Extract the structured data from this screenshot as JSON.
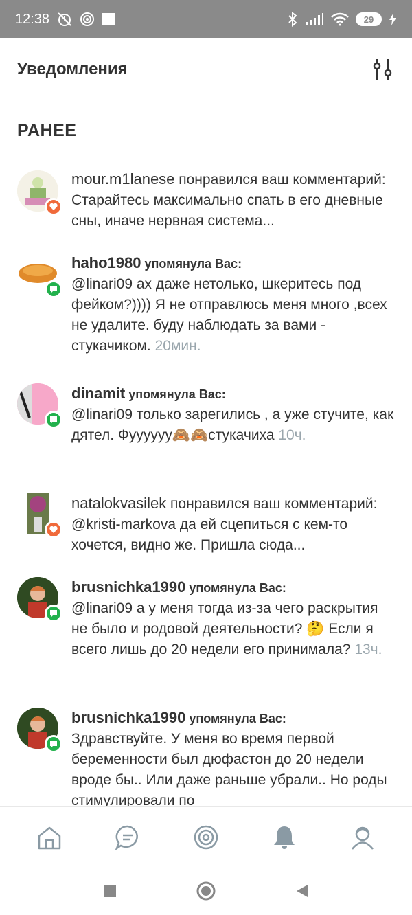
{
  "status_bar": {
    "time": "12:38",
    "battery": "29"
  },
  "header": {
    "title": "Уведомления"
  },
  "section": {
    "title": "РАНЕЕ"
  },
  "notifications": [
    {
      "user": "mour.m1lanese",
      "action": " понравился ваш",
      "body": "комментарий: Старайтесь максимально спать в его дневные сны, иначе нервная система...",
      "time": "",
      "type": "like",
      "avatar_color": "#cfe3a9"
    },
    {
      "user": "haho1980",
      "action": " упомянула Вас:",
      "body": "@linari09 ах даже нетолько, шкеритесь под фейком?)))) Я не отправлюсь меня много ,всех не удалите. буду наблюдать за вами - стукачиком.",
      "time": "20мин.",
      "type": "comment",
      "avatar_color": "#e08a2a"
    },
    {
      "user": "dinamit",
      "action": " упомянула Вас:",
      "body": "@linari09 только зарегились , а уже стучите, как дятел. Фуууууу🙈🙈стукачиха",
      "time": "10ч.",
      "type": "comment",
      "avatar_color": "#f7a8c9"
    },
    {
      "user": "natalokvasilek",
      "action": " понравился ваш",
      "body": "комментарий: @kristi-markova да ей сцепиться с кем-то хочется, видно же. Пришла сюда...",
      "time": "",
      "type": "like",
      "avatar_color": "#a3437f"
    },
    {
      "user": "brusnichka1990",
      "action": " упомянула Вас:",
      "body": "@linari09  а у меня тогда из-за чего раскрытия не было и родовой деятельности? 🤔 Если я всего лишь до 20 недели его принимала?",
      "time": "13ч.",
      "type": "comment",
      "avatar_color": "#3b5e2a"
    },
    {
      "user": "brusnichka1990",
      "action": " упомянула Вас:",
      "body": "Здравствуйте. У меня во время первой беременности был дюфастон до 20 недели вроде бы.. Или даже раньше убрали.. Но роды стимулировали по",
      "time": "",
      "type": "comment",
      "avatar_color": "#3b5e2a"
    }
  ],
  "bottom_nav": [
    "home-icon",
    "chat-icon",
    "target-icon",
    "bell-icon",
    "profile-icon"
  ],
  "colors": {
    "like": "#f06a3b",
    "comment": "#22b14c",
    "muted": "#9aa6ad"
  }
}
